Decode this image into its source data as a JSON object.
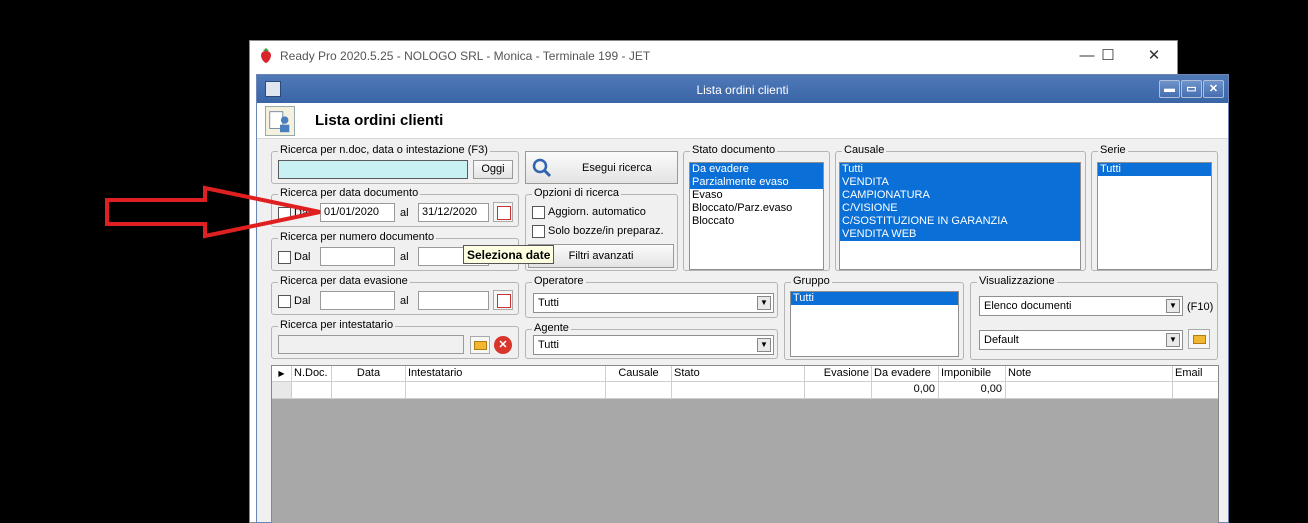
{
  "app": {
    "title": "Ready Pro 2020.5.25 - NOLOGO SRL - Monica - Terminale 199 - JET",
    "minimize": "—",
    "maximize": "☐",
    "close": "✕"
  },
  "window": {
    "title": "Lista ordini clienti",
    "header": "Lista ordini clienti",
    "btn_min": "▬",
    "btn_max": "▭",
    "btn_close": "✕"
  },
  "search_ndoc": {
    "label": "Ricerca per n.doc, data o intestazione (F3)",
    "value": "",
    "today_btn": "Oggi"
  },
  "search_btn": "Esegui ricerca",
  "by_doc_date": {
    "label": "Ricerca per data documento",
    "dal": "Dal",
    "from": "01/01/2020",
    "al": "al",
    "to": "31/12/2020"
  },
  "by_doc_number": {
    "label": "Ricerca per numero documento",
    "dal": "Dal",
    "al": "al"
  },
  "by_eva_date": {
    "label": "Ricerca per data evasione",
    "dal": "Dal",
    "al": "al"
  },
  "by_holder": {
    "label": "Ricerca per intestatario"
  },
  "options": {
    "label": "Opzioni di ricerca",
    "auto_update": "Aggiorn. automatico",
    "drafts_only": "Solo bozze/in preparaz.",
    "adv_filters": "Filtri avanzati"
  },
  "tooltip": "Seleziona date",
  "doc_state": {
    "label": "Stato documento",
    "items": [
      {
        "text": "Da evadere",
        "selected": true
      },
      {
        "text": "Parzialmente evaso",
        "selected": true
      },
      {
        "text": "Evaso",
        "selected": false
      },
      {
        "text": "Bloccato/Parz.evaso",
        "selected": false
      },
      {
        "text": "Bloccato",
        "selected": false
      }
    ]
  },
  "causale": {
    "label": "Causale",
    "items": [
      "Tutti",
      "VENDITA",
      "CAMPIONATURA",
      "C/VISIONE",
      "C/SOSTITUZIONE IN GARANZIA",
      "VENDITA WEB"
    ]
  },
  "serie": {
    "label": "Serie",
    "items": [
      "Tutti"
    ]
  },
  "operator": {
    "label": "Operatore",
    "value": "Tutti"
  },
  "agent": {
    "label": "Agente",
    "value": "Tutti"
  },
  "group": {
    "label": "Gruppo",
    "items": [
      "Tutti"
    ]
  },
  "view": {
    "label": "Visualizzazione",
    "value": "Elenco documenti",
    "shortcut": "(F10)",
    "layout": "Default"
  },
  "grid": {
    "columns": [
      "N.Doc.",
      "Data",
      "Intestatario",
      "Causale",
      "Stato",
      "Evasione",
      "Da evadere",
      "Imponibile",
      "Note",
      "Email"
    ],
    "rows": [
      {
        "da_evadere": "0,00",
        "imponibile": "0,00"
      }
    ]
  },
  "colors": {
    "selection": "#0a6fd6",
    "title_bar": "#3a65a7",
    "annotation_arrow": "#e02020"
  }
}
